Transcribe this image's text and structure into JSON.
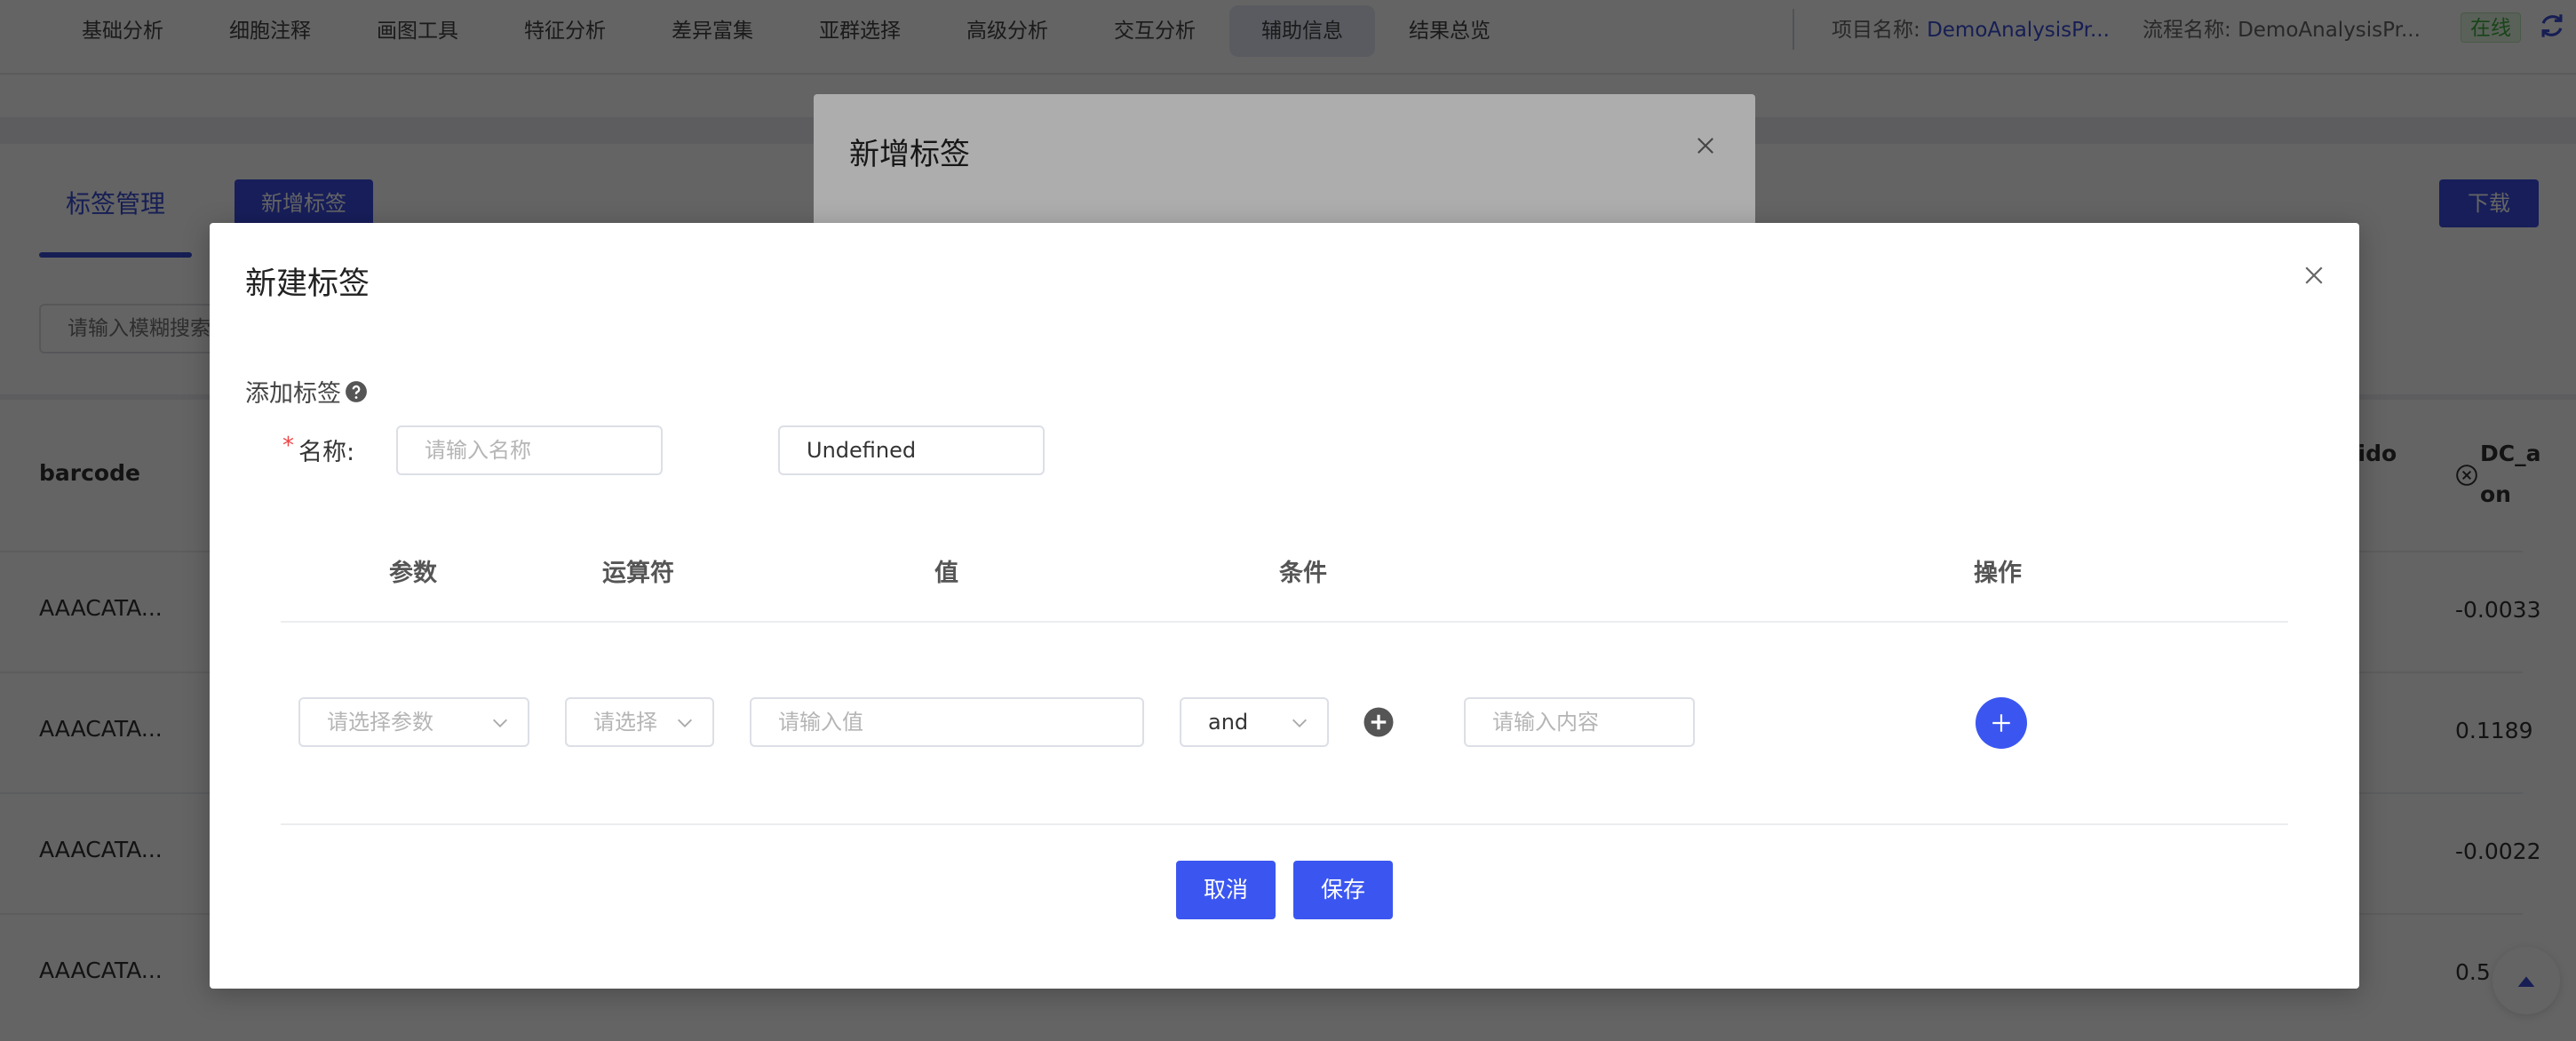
{
  "nav": {
    "items": [
      {
        "label": "基础分析"
      },
      {
        "label": "细胞注释"
      },
      {
        "label": "画图工具"
      },
      {
        "label": "特征分析"
      },
      {
        "label": "差异富集"
      },
      {
        "label": "亚群选择"
      },
      {
        "label": "高级分析"
      },
      {
        "label": "交互分析"
      },
      {
        "label": "辅助信息"
      },
      {
        "label": "结果总览"
      }
    ],
    "active_index": 8,
    "project_label": "项目名称:",
    "project_value": "DemoAnalysisPr...",
    "flow_label": "流程名称:",
    "flow_value": "DemoAnalysisPr...",
    "status": "在线"
  },
  "page": {
    "tab_label": "标签管理",
    "add_tag_button": "新增标签",
    "download_button": "下载",
    "search_placeholder": "请输入模糊搜索"
  },
  "table": {
    "columns": [
      "barcode",
      "azido",
      "DC_a on"
    ],
    "col_azido_label": "zido",
    "col_dc_label_1": "DC_a",
    "col_dc_label_2": "on",
    "rows": [
      {
        "barcode": "AAACATA...",
        "dc": "-0.0033"
      },
      {
        "barcode": "AAACATA...",
        "dc": "0.1189"
      },
      {
        "barcode": "AAACATA...",
        "dc": "-0.0022"
      },
      {
        "barcode": "AAACATA...",
        "dc": "0.5"
      }
    ]
  },
  "dialog_back": {
    "title": "新增标签"
  },
  "dialog": {
    "title": "新建标签",
    "section_label": "添加标签",
    "name_label": "名称:",
    "name_placeholder": "请输入名称",
    "name_secondary_value": "Undefined",
    "headers": {
      "param": "参数",
      "operator": "运算符",
      "value": "值",
      "condition": "条件",
      "action": "操作"
    },
    "row": {
      "param_placeholder": "请选择参数",
      "operator_placeholder": "请选择",
      "value_placeholder": "请输入值",
      "condition_value": "and",
      "content_placeholder": "请输入内容"
    },
    "cancel_button": "取消",
    "save_button": "保存"
  },
  "colors": {
    "primary": "#3b56f0",
    "link": "#3a4fd8",
    "online": "#3fae3f"
  }
}
